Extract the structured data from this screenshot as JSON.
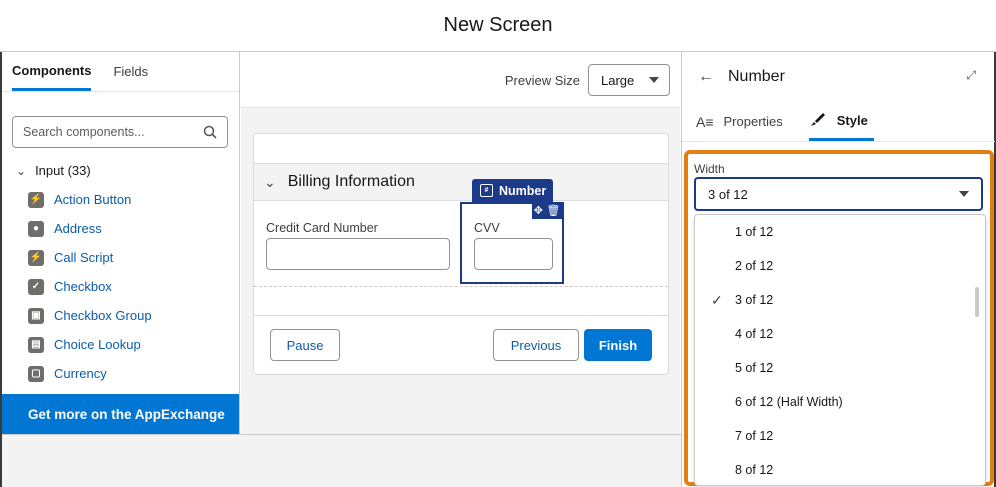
{
  "header": {
    "title": "New Screen"
  },
  "left": {
    "tabs": [
      {
        "label": "Components"
      },
      {
        "label": "Fields"
      }
    ],
    "search_placeholder": "Search components...",
    "section": "Input (33)",
    "items": [
      {
        "label": "Action Button",
        "icon": "action-button-icon"
      },
      {
        "label": "Address",
        "icon": "address-icon"
      },
      {
        "label": "Call Script",
        "icon": "call-script-icon"
      },
      {
        "label": "Checkbox",
        "icon": "checkbox-icon"
      },
      {
        "label": "Checkbox Group",
        "icon": "checkbox-group-icon"
      },
      {
        "label": "Choice Lookup",
        "icon": "choice-lookup-icon"
      },
      {
        "label": "Currency",
        "icon": "currency-icon"
      }
    ],
    "appexchange": "Get more on the AppExchange"
  },
  "middle": {
    "preview_label": "Preview Size",
    "preview_value": "Large",
    "section_title": "Billing Information",
    "credit_label": "Credit Card Number",
    "cvv_label": "CVV",
    "badge": "Number",
    "buttons": {
      "pause": "Pause",
      "previous": "Previous",
      "finish": "Finish"
    }
  },
  "right": {
    "title": "Number",
    "tabs": [
      {
        "label": "Properties"
      },
      {
        "label": "Style"
      }
    ],
    "width_label": "Width",
    "width_value": "3 of 12",
    "options": [
      {
        "label": "1 of 12",
        "selected": false
      },
      {
        "label": "2 of 12",
        "selected": false
      },
      {
        "label": "3 of 12",
        "selected": true
      },
      {
        "label": "4 of 12",
        "selected": false
      },
      {
        "label": "5 of 12",
        "selected": false
      },
      {
        "label": "6 of 12 (Half Width)",
        "selected": false
      },
      {
        "label": "7 of 12",
        "selected": false
      },
      {
        "label": "8 of 12",
        "selected": false
      }
    ]
  },
  "colors": {
    "brand": "#0176d3",
    "highlight": "#e37e12",
    "selection": "#1b3a8a"
  }
}
